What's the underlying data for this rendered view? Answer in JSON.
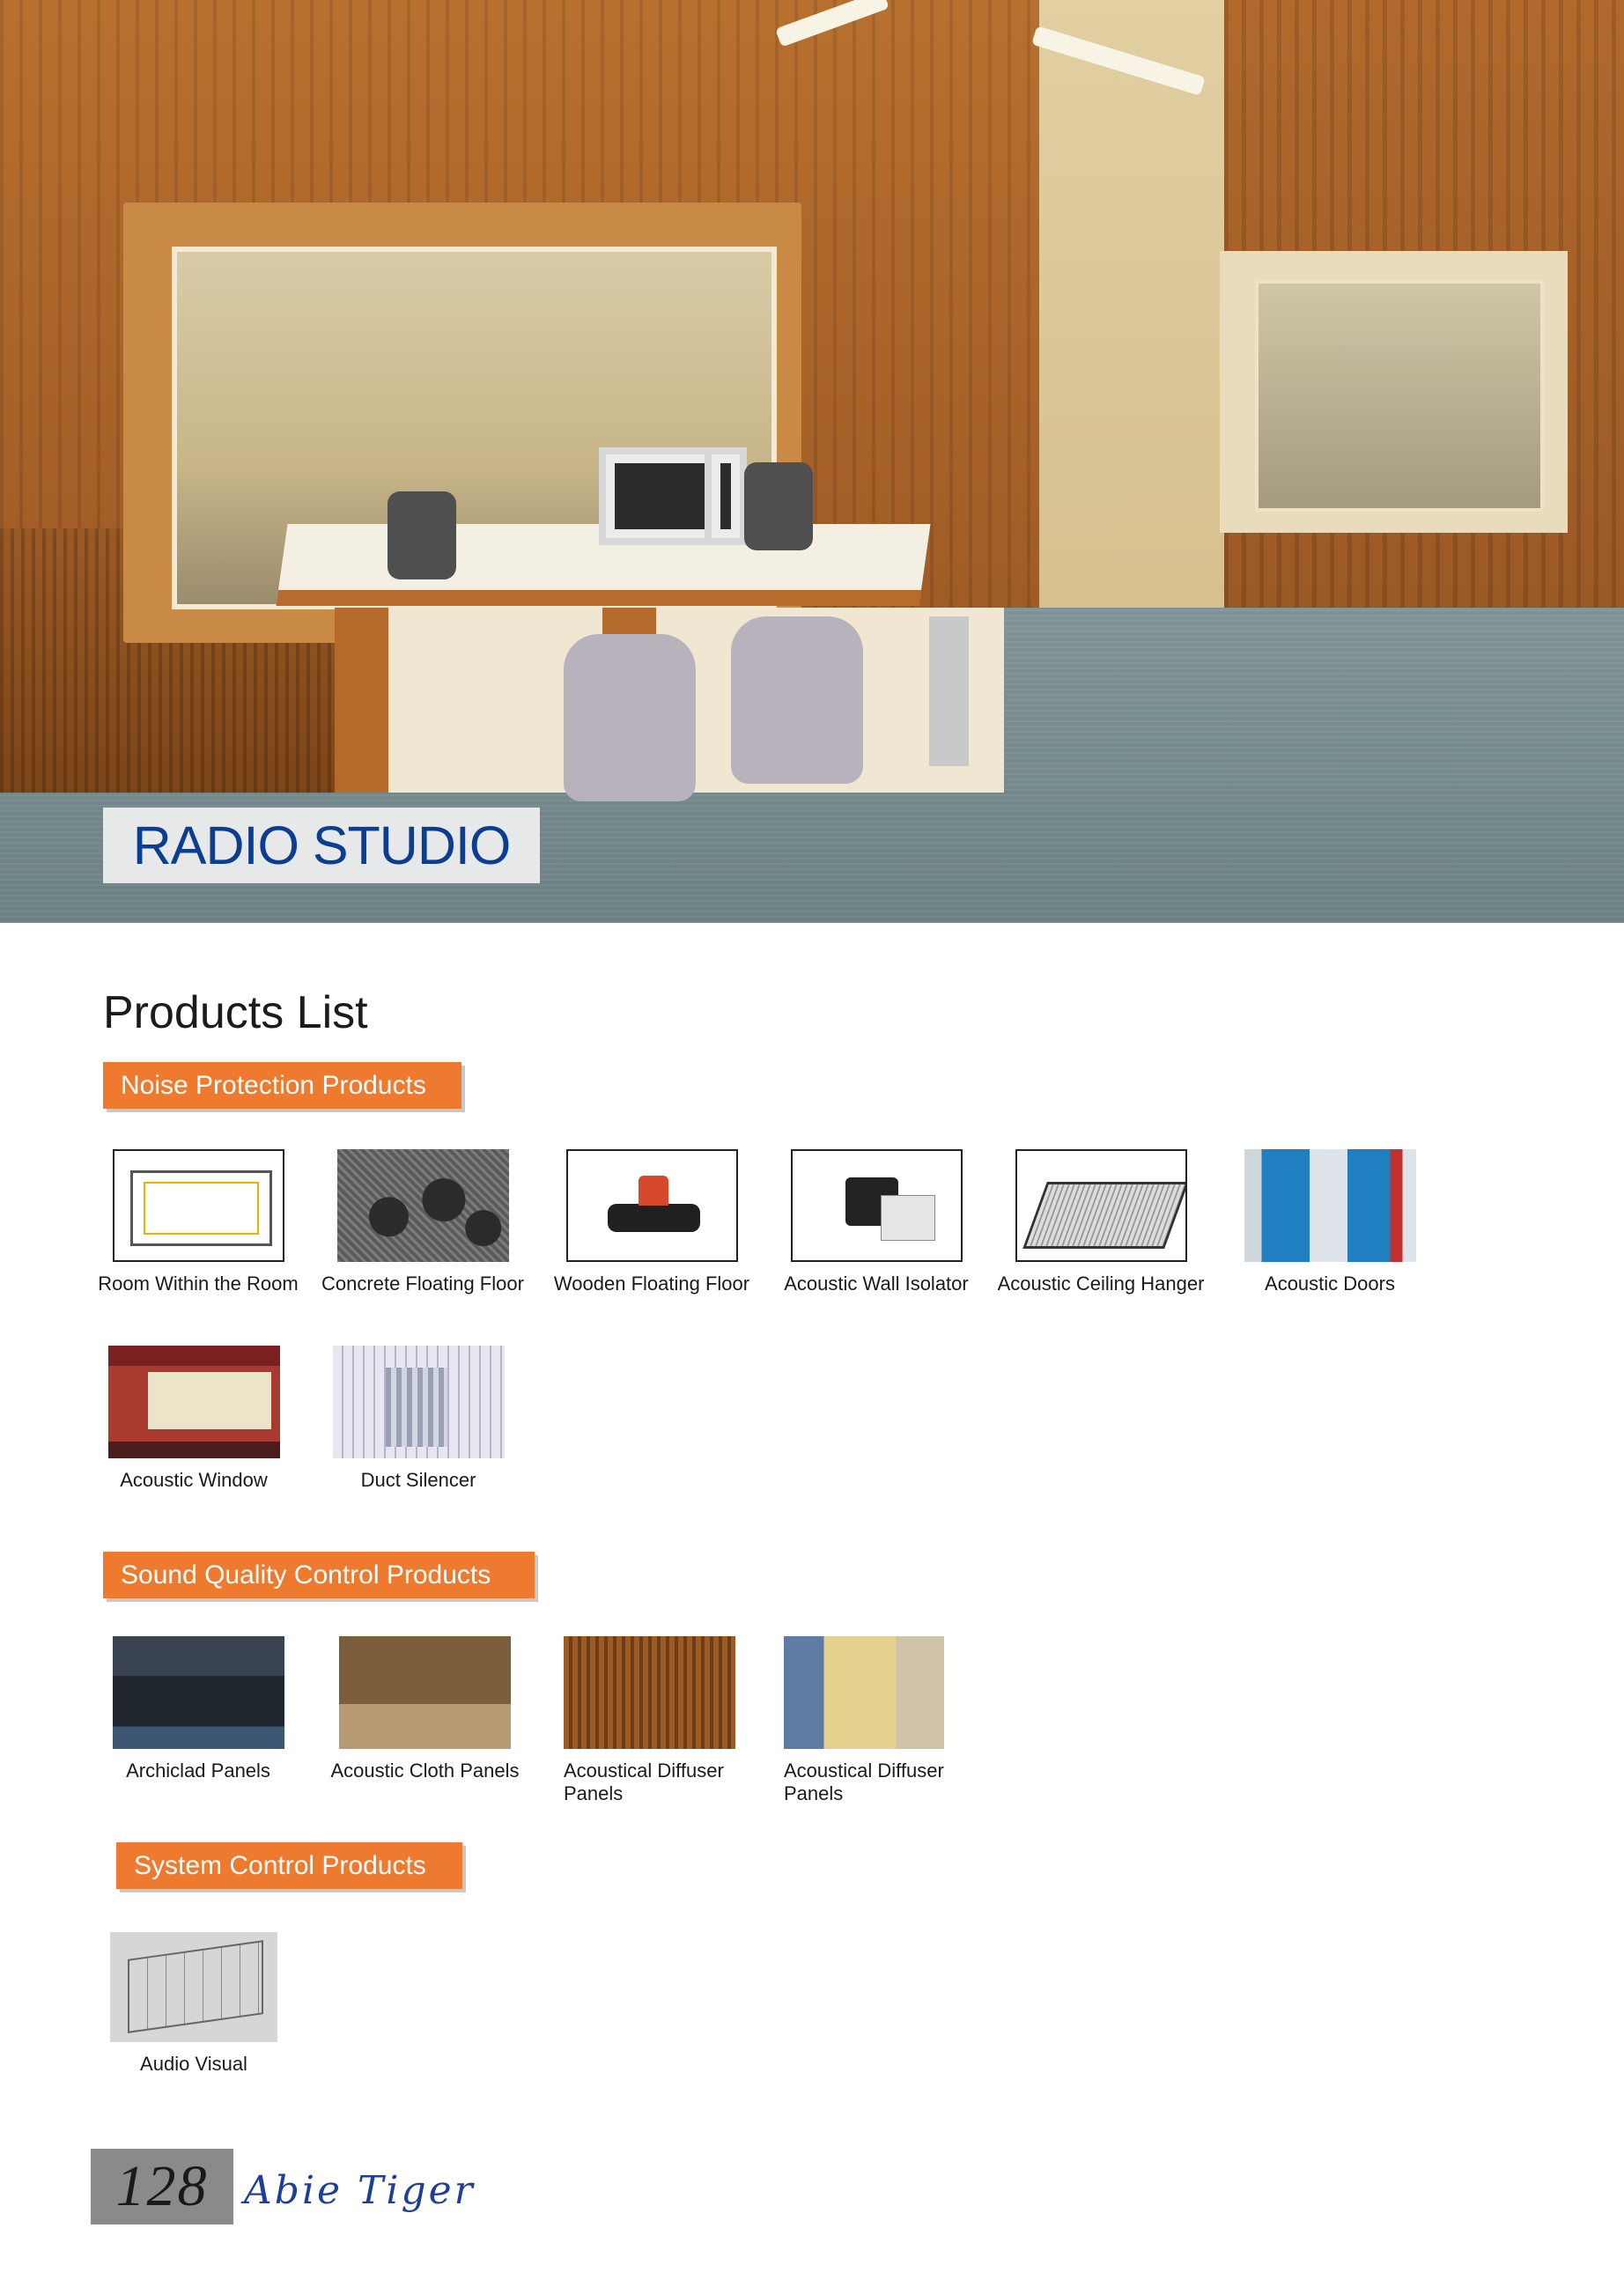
{
  "hero": {
    "title": "RADIO STUDIO"
  },
  "products_title": "Products List",
  "sections": [
    {
      "heading": "Noise Protection Products",
      "items": [
        {
          "label": "Room Within the Room",
          "icon": "room-within-room-diagram"
        },
        {
          "label": "Concrete Floating Floor",
          "icon": "concrete-floating-floor-photo"
        },
        {
          "label": "Wooden Floating Floor",
          "icon": "wooden-floating-floor-isolator"
        },
        {
          "label": "Acoustic Wall Isolator",
          "icon": "acoustic-wall-isolator-bracket"
        },
        {
          "label": "Acoustic Ceiling Hanger",
          "icon": "acoustic-ceiling-hanger-diagram"
        },
        {
          "label": "Acoustic Doors",
          "icon": "acoustic-doors-photo"
        },
        {
          "label": "Acoustic Window",
          "icon": "acoustic-window-photo"
        },
        {
          "label": "Duct Silencer",
          "icon": "duct-silencer-photo"
        }
      ]
    },
    {
      "heading": "Sound Quality Control Products",
      "items": [
        {
          "label": "Archiclad Panels",
          "icon": "archiclad-panels-photo"
        },
        {
          "label": "Acoustic Cloth Panels",
          "icon": "acoustic-cloth-panels-photo"
        },
        {
          "label": "Acoustical Diffuser Panels",
          "icon": "acoustical-diffuser-panels-photo"
        },
        {
          "label": "Acoustical Diffuser Panels",
          "icon": "acoustical-diffuser-panels-photo"
        }
      ]
    },
    {
      "heading": "System Control Products",
      "items": [
        {
          "label": "Audio Visual",
          "icon": "audio-visual-diagram"
        }
      ]
    }
  ],
  "footer": {
    "page_number": "128",
    "brand": "Abie Tiger"
  },
  "colors": {
    "banner": "#ee7a2f",
    "hero_title": "#0b3e90",
    "brand": "#1e3f97"
  }
}
